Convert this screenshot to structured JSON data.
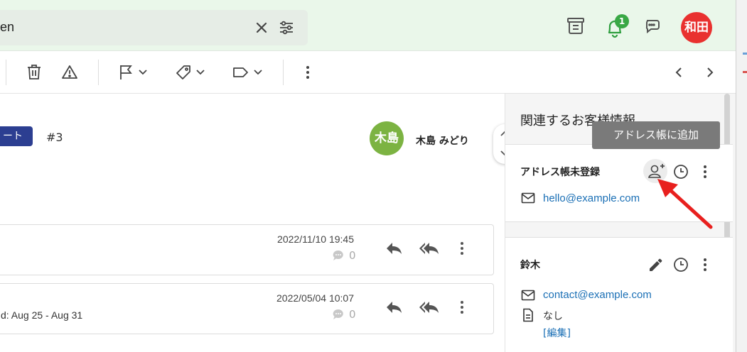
{
  "search": {
    "value": "en"
  },
  "topbar": {
    "notification_count": "1",
    "user_initials": "和田"
  },
  "ticket": {
    "tag_label": "ート",
    "number": "#3",
    "assignee_initials": "木島",
    "assignee_name": "木島 みどり"
  },
  "messages": [
    {
      "date": "2022/11/10 19:45",
      "subject": "",
      "comment_count": "0"
    },
    {
      "date": "2022/05/04 10:07",
      "subject": "d: Aug 25 - Aug 31",
      "comment_count": "0"
    }
  ],
  "side": {
    "title": "関連するお客様情報",
    "tooltip": "アドレス帳に追加",
    "contacts": [
      {
        "name": "アドレス帳未登録",
        "email": "hello@example.com"
      },
      {
        "name": "鈴木",
        "email": "contact@example.com",
        "note": "なし",
        "edit_link": "[編集]"
      }
    ]
  },
  "colors": {
    "topbar_bg": "#eaf7ea",
    "accent_blue": "#1a6fb5",
    "tag_navy": "#2c3e91",
    "notify_green": "#39a845",
    "avatar_red": "#e9312f",
    "avatar_green": "#7cb342",
    "arrow_red": "#e8201e"
  }
}
